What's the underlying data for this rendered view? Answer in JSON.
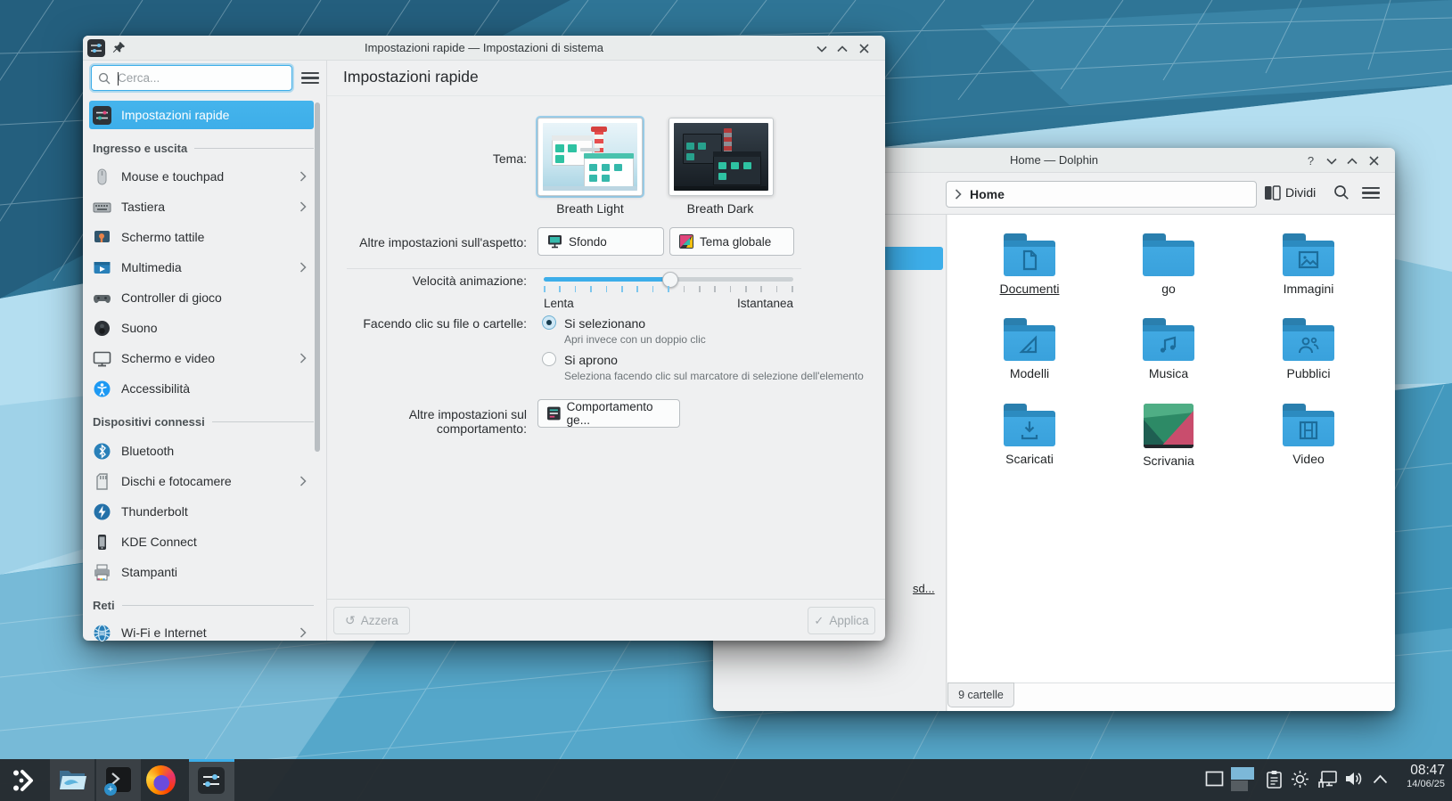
{
  "settings": {
    "title": "Impostazioni rapide — Impostazioni di sistema",
    "search_placeholder": "Cerca...",
    "header": "Impostazioni rapide",
    "sidebar": [
      {
        "label": "Impostazioni rapide",
        "selected": true
      },
      {
        "section": "Ingresso e uscita"
      },
      {
        "label": "Mouse e touchpad",
        "chevron": true
      },
      {
        "label": "Tastiera",
        "chevron": true
      },
      {
        "label": "Schermo tattile"
      },
      {
        "label": "Multimedia",
        "chevron": true
      },
      {
        "label": "Controller di gioco"
      },
      {
        "label": "Suono"
      },
      {
        "label": "Schermo e video",
        "chevron": true
      },
      {
        "label": "Accessibilità"
      },
      {
        "section": "Dispositivi connessi"
      },
      {
        "label": "Bluetooth"
      },
      {
        "label": "Dischi e fotocamere",
        "chevron": true
      },
      {
        "label": "Thunderbolt"
      },
      {
        "label": "KDE Connect"
      },
      {
        "label": "Stampanti"
      },
      {
        "section": "Reti"
      },
      {
        "label": "Wi-Fi e Internet",
        "chevron": true
      }
    ],
    "content": {
      "tema_label": "Tema:",
      "theme_light": "Breath Light",
      "theme_dark": "Breath Dark",
      "aspetto_label": "Altre impostazioni sull'aspetto:",
      "btn_sfondo": "Sfondo",
      "btn_tema_globale": "Tema globale",
      "velocita_label": "Velocità animazione:",
      "slider_min": "Lenta",
      "slider_max": "Istantanea",
      "clic_label": "Facendo clic su file o cartelle:",
      "radio_select": "Si selezionano",
      "radio_select_desc": "Apri invece con un doppio clic",
      "radio_open": "Si aprono",
      "radio_open_desc": "Seleziona facendo clic sul marcatore di selezione dell'elemento",
      "comportamento_label": "Altre impostazioni sul comportamento:",
      "btn_comportamento": "Comportamento ge...",
      "btn_azzera": "Azzera",
      "btn_applica": "Applica"
    }
  },
  "dolphin": {
    "title": "Home — Dolphin",
    "breadcrumb": "Home",
    "btn_dividi": "Dividi",
    "places_item_truncated": "sd...",
    "folders": [
      {
        "name": "Documenti"
      },
      {
        "name": "go"
      },
      {
        "name": "Immagini"
      },
      {
        "name": "Modelli"
      },
      {
        "name": "Musica"
      },
      {
        "name": "Pubblici"
      },
      {
        "name": "Scaricati"
      },
      {
        "name": "Scrivania"
      },
      {
        "name": "Video"
      }
    ],
    "status": "9 cartelle"
  },
  "taskbar": {
    "time": "08:47",
    "date": "14/06/25"
  },
  "colors": {
    "accent": "#3daee9",
    "window_bg": "#eff0f1",
    "taskbar_bg": "#24292d",
    "folder_blue": "#3daee9"
  }
}
